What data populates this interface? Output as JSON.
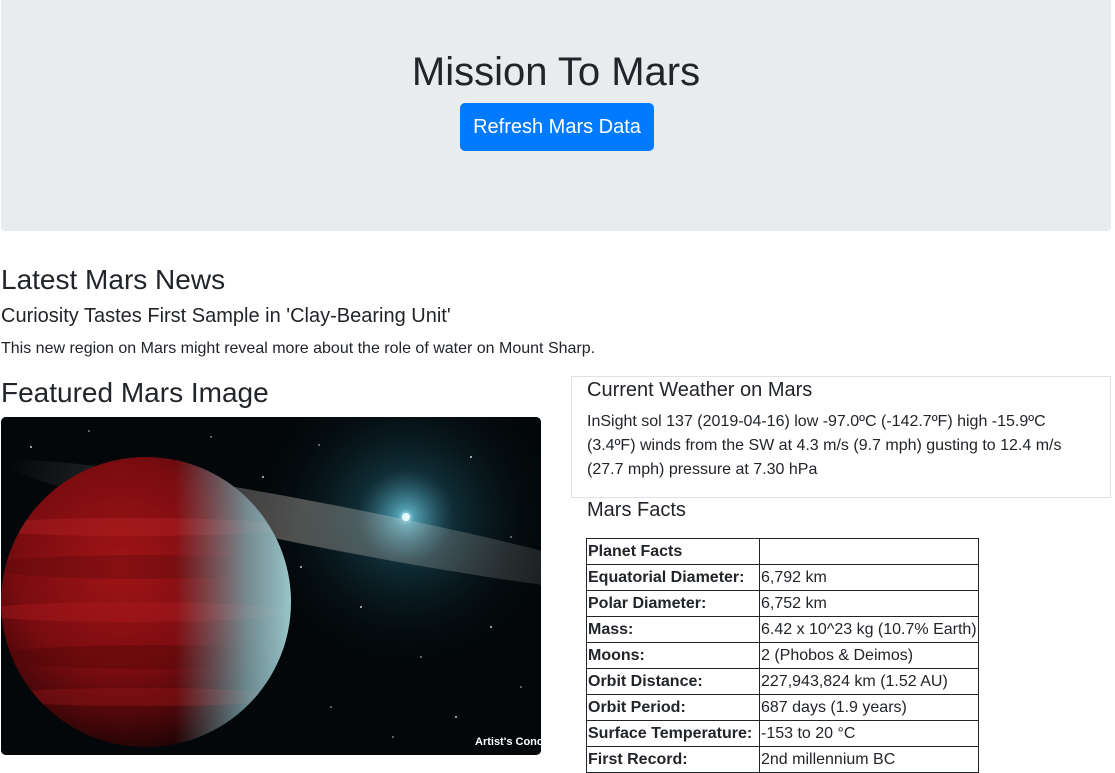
{
  "header": {
    "title": "Mission To Mars",
    "refresh_label": "Refresh Mars Data"
  },
  "news": {
    "heading": "Latest Mars News",
    "title": "Curiosity Tastes First Sample in 'Clay-Bearing Unit'",
    "paragraph": "This new region on Mars might reveal more about the role of water on Mount Sharp."
  },
  "featured": {
    "heading": "Featured Mars Image",
    "caption": "Artist's Concept"
  },
  "weather": {
    "heading": "Current Weather on Mars",
    "text": "InSight sol 137 (2019-04-16) low -97.0ºC (-142.7ºF) high -15.9ºC (3.4ºF) winds from the SW at 4.3 m/s (9.7 mph) gusting to 12.4 m/s (27.7 mph) pressure at 7.30 hPa"
  },
  "facts": {
    "heading": "Mars Facts",
    "rows": [
      {
        "label": "Planet Facts",
        "value": ""
      },
      {
        "label": "Equatorial Diameter:",
        "value": "6,792 km"
      },
      {
        "label": "Polar Diameter:",
        "value": "6,752 km"
      },
      {
        "label": "Mass:",
        "value": "6.42 x 10^23 kg (10.7% Earth)"
      },
      {
        "label": "Moons:",
        "value": "2 (Phobos & Deimos)"
      },
      {
        "label": "Orbit Distance:",
        "value": "227,943,824 km (1.52 AU)"
      },
      {
        "label": "Orbit Period:",
        "value": "687 days (1.9 years)"
      },
      {
        "label": "Surface Temperature:",
        "value": "-153 to 20 °C"
      },
      {
        "label": "First Record:",
        "value": "2nd millennium BC"
      }
    ]
  },
  "colors": {
    "jumbotron_bg": "#e9ecef",
    "button_primary": "#007bff",
    "text": "#212529"
  }
}
